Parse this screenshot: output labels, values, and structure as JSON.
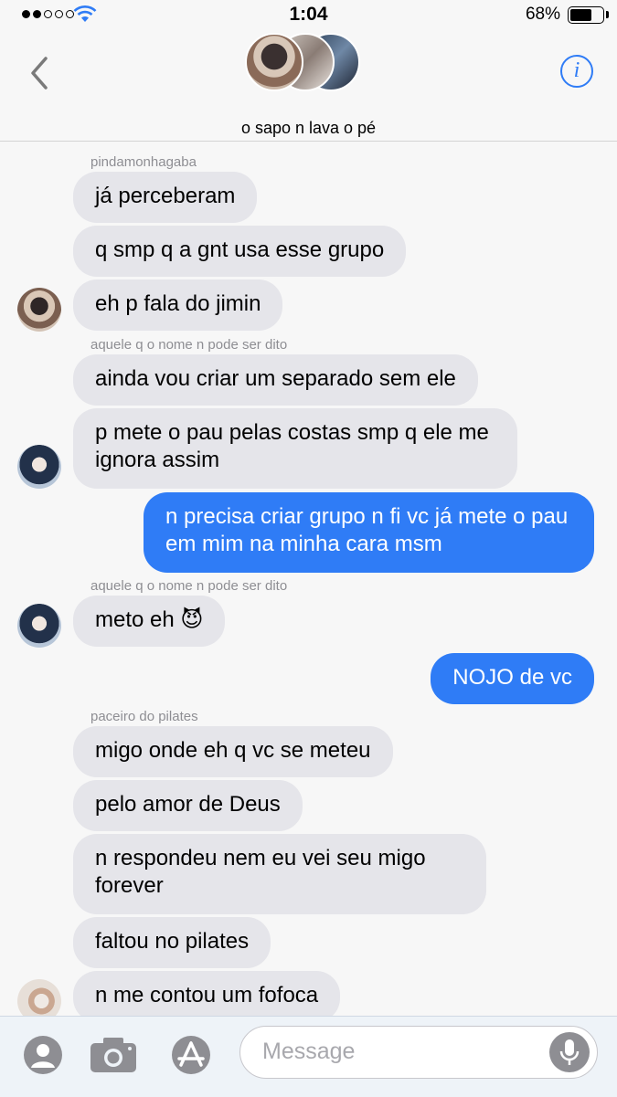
{
  "status_bar": {
    "time": "1:04",
    "battery": "68%"
  },
  "header": {
    "title": "o sapo n lava o pé"
  },
  "messages": [
    {
      "sender": "pindamonhagaba"
    },
    {
      "text": "já perceberam"
    },
    {
      "text": "q smp q a gnt usa esse grupo"
    },
    {
      "text": "eh p fala do jimin"
    },
    {
      "sender": "aquele q o nome n pode ser dito"
    },
    {
      "text": "ainda vou criar um separado sem ele"
    },
    {
      "text": "p mete o pau pelas costas smp q ele me ignora assim"
    },
    {
      "text": "n precisa criar grupo n fi vc já mete o pau em mim na minha cara msm"
    },
    {
      "sender": "aquele q o nome n pode ser dito"
    },
    {
      "text": "meto eh 😈"
    },
    {
      "text": "NOJO de vc"
    },
    {
      "sender": "paceiro do pilates"
    },
    {
      "text": "migo onde eh q vc se meteu"
    },
    {
      "text": "pelo amor de Deus"
    },
    {
      "text": "n respondeu nem eu vei seu migo forever"
    },
    {
      "text": "faltou no pilates"
    },
    {
      "text": "n me contou um fofoca"
    }
  ],
  "input": {
    "placeholder": "Message"
  },
  "icons": {
    "back": "chevron-left-icon",
    "info": "info-icon",
    "contact": "person-icon",
    "camera": "camera-icon",
    "apps": "app-store-icon",
    "mic": "microphone-icon"
  },
  "colors": {
    "accent": "#2f7cf6",
    "incoming": "#e5e5ea",
    "sender_label": "#8e8e93"
  }
}
